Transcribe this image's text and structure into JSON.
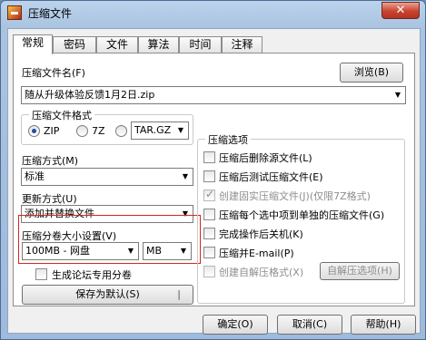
{
  "window": {
    "title": "压缩文件",
    "close_glyph": "✕"
  },
  "tabs": [
    "常规",
    "密码",
    "文件",
    "算法",
    "时间",
    "注释"
  ],
  "archive_name": {
    "label": "压缩文件名(F)",
    "browse_button": "浏览(B)",
    "value": "随从升级体验反馈1月2日.zip"
  },
  "format": {
    "legend": "压缩文件格式",
    "options": [
      "ZIP",
      "7Z",
      "TAR.GZ"
    ],
    "selected": "ZIP"
  },
  "method": {
    "label": "压缩方式(M)",
    "value": "标准"
  },
  "update": {
    "label": "更新方式(U)",
    "value": "添加并替换文件"
  },
  "split": {
    "label": "压缩分卷大小设置(V)",
    "value": "100MB - 网盘",
    "unit": "MB"
  },
  "forum_split_checkbox": {
    "label": "生成论坛专用分卷",
    "checked": false
  },
  "save_default_button": "保存为默认(S)",
  "options": {
    "legend": "压缩选项",
    "items": [
      {
        "label": "压缩后删除源文件(L)",
        "checked": false,
        "disabled": false
      },
      {
        "label": "压缩后测试压缩文件(E)",
        "checked": false,
        "disabled": false
      },
      {
        "label": "创建固实压缩文件(J)(仅限7Z格式)",
        "checked": true,
        "disabled": true
      },
      {
        "label": "压缩每个选中项到单独的压缩文件(G)",
        "checked": false,
        "disabled": false
      },
      {
        "label": "完成操作后关机(K)",
        "checked": false,
        "disabled": false
      },
      {
        "label": "压缩并E-mail(P)",
        "checked": false,
        "disabled": false
      },
      {
        "label": "创建自解压格式(X)",
        "checked": false,
        "disabled": true
      }
    ],
    "sfx_button": "自解压选项(H)"
  },
  "footer": {
    "ok": "确定(O)",
    "cancel": "取消(C)",
    "help": "帮助(H)"
  }
}
